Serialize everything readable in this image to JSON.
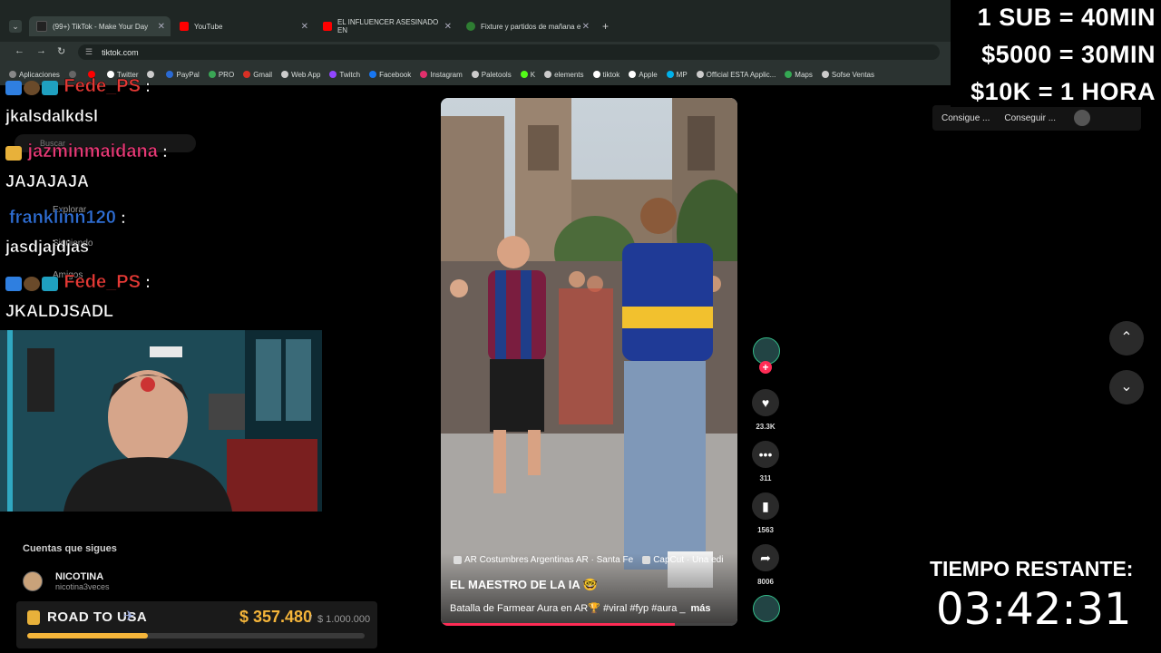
{
  "browser": {
    "tabs": [
      {
        "title": "(99+) TikTok - Make Your Day",
        "color": "#222222",
        "active": true
      },
      {
        "title": "YouTube",
        "color": "#ff0000",
        "active": false
      },
      {
        "title": "EL INFLUENCER ASESINADO EN",
        "color": "#ff0000",
        "active": false
      },
      {
        "title": "Fixture y partidos de mañana e",
        "color": "#2e7d32",
        "active": false
      }
    ],
    "url": "tiktok.com",
    "bookmarks": [
      {
        "label": "Aplicaciones",
        "color": "#888888"
      },
      {
        "label": "",
        "color": "#666666"
      },
      {
        "label": "",
        "color": "#ff0000"
      },
      {
        "label": "Twitter",
        "color": "#ffffff"
      },
      {
        "label": "",
        "color": "#cccccc"
      },
      {
        "label": "PayPal",
        "color": "#2a6ad3"
      },
      {
        "label": "PRO",
        "color": "#3aa655"
      },
      {
        "label": "Gmail",
        "color": "#d93025"
      },
      {
        "label": "Web App",
        "color": "#cccccc"
      },
      {
        "label": "Twitch",
        "color": "#9146ff"
      },
      {
        "label": "Facebook",
        "color": "#1877f2"
      },
      {
        "label": "Instagram",
        "color": "#e1306c"
      },
      {
        "label": "Paletools",
        "color": "#cccccc"
      },
      {
        "label": "K",
        "color": "#53fc18"
      },
      {
        "label": "elements",
        "color": "#cccccc"
      },
      {
        "label": "tiktok",
        "color": "#ffffff"
      },
      {
        "label": "Apple",
        "color": "#ffffff"
      },
      {
        "label": "MP",
        "color": "#00b1ea"
      },
      {
        "label": "Official ESTA Applic...",
        "color": "#cccccc"
      },
      {
        "label": "Maps",
        "color": "#34a853"
      },
      {
        "label": "Sofse Ventas",
        "color": "#cccccc"
      }
    ]
  },
  "sidebar": {
    "search_placeholder": "Buscar",
    "nav": [
      "Explorar",
      "Siguiendo",
      "Amigos"
    ],
    "following_title": "Cuentas que sigues",
    "following": {
      "name": "NICOTINA",
      "handle": "nicotina3veces"
    }
  },
  "video": {
    "chips": [
      "AR Costumbres Argentinas AR · Santa Fe",
      "CapCut · Una edi"
    ],
    "author": "EL MAESTRO DE LA IA 🤓",
    "caption": "Batalla de Farmear Aura en AR🏆 #viral #fyp #aura _",
    "more": "más",
    "progress": 0.79
  },
  "actions": {
    "likes": "23.3K",
    "comments": "311",
    "saves": "1563",
    "shares": "8006"
  },
  "promo": {
    "items": [
      "Consigue ...",
      "Conseguir ..."
    ]
  },
  "chat": [
    {
      "user": "Fede_PS",
      "message": "jkalsdalkdsl",
      "color": "#e53935"
    },
    {
      "user": "jazminmaidana",
      "message": "JAJAJAJA",
      "color": "#e53975"
    },
    {
      "user": "franklinn120",
      "message": "jasdjajdjas",
      "color": "#2f6fd6"
    },
    {
      "user": "Fede_PS",
      "message": "JKALDJSADL",
      "color": "#e53935"
    }
  ],
  "overlay": {
    "sub_rules": [
      "1 SUB = 40MIN",
      "$5000 = 30MIN",
      "$10K = 1 HORA"
    ],
    "timer_label": "TIEMPO RESTANTE:",
    "timer_value": "03:42:31"
  },
  "goal": {
    "title": "ROAD TO USA",
    "current": "$ 357.480",
    "separator": "/",
    "target": "$ 1.000.000",
    "progress": 0.357
  }
}
